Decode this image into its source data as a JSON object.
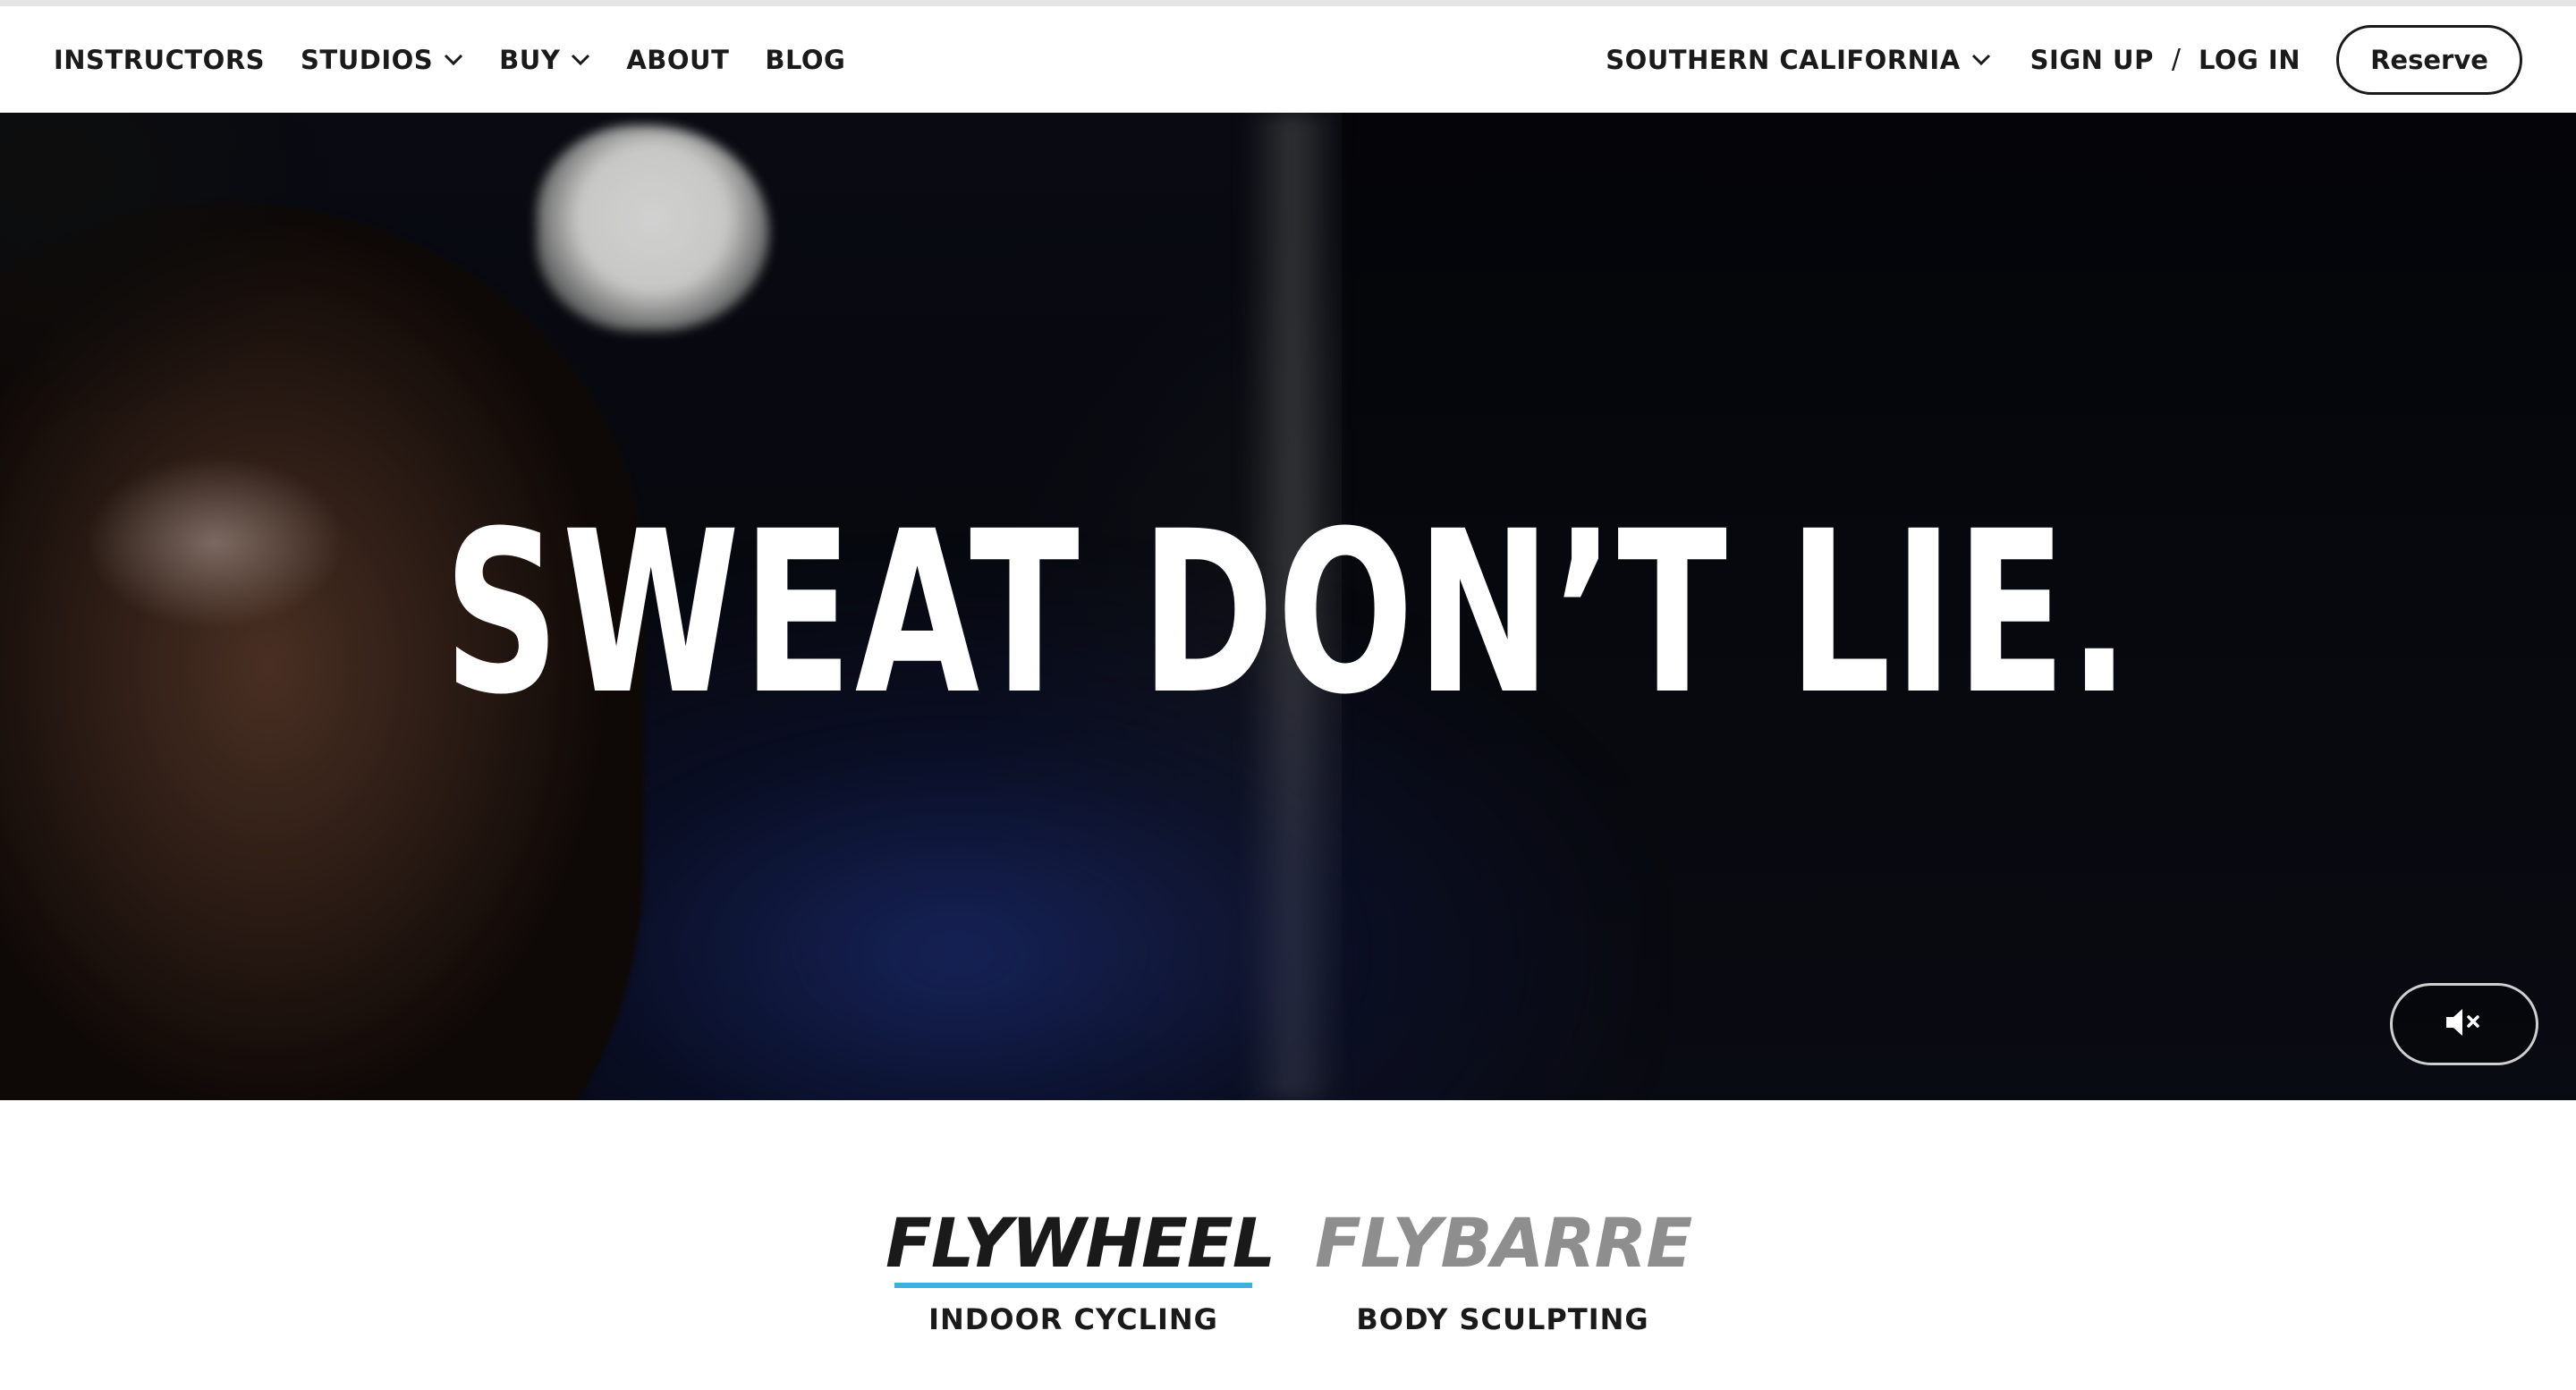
{
  "nav": {
    "left": [
      {
        "label": "INSTRUCTORS",
        "dropdown": false
      },
      {
        "label": "STUDIOS",
        "dropdown": true
      },
      {
        "label": "BUY",
        "dropdown": true
      },
      {
        "label": "ABOUT",
        "dropdown": false
      },
      {
        "label": "BLOG",
        "dropdown": false
      }
    ],
    "region": "SOUTHERN CALIFORNIA",
    "sign_up": "SIGN UP",
    "separator": "/",
    "log_in": "LOG IN",
    "reserve": "Reserve"
  },
  "hero": {
    "headline": "SWEAT DON’T LIE.",
    "mute_icon": "speaker-muted-icon"
  },
  "brands": [
    {
      "logo": "FLYWHEEL",
      "subtitle": "INDOOR CYCLING",
      "active": true
    },
    {
      "logo": "FLYBARRE",
      "subtitle": "BODY SCULPTING",
      "active": false
    }
  ],
  "colors": {
    "text": "#1a1a1a",
    "accent": "#3ab3df",
    "inactive_logo": "#8e8e8e",
    "hero_bg": "#07090f"
  },
  "icons": [
    "chevron-down-icon",
    "speaker-muted-icon"
  ]
}
